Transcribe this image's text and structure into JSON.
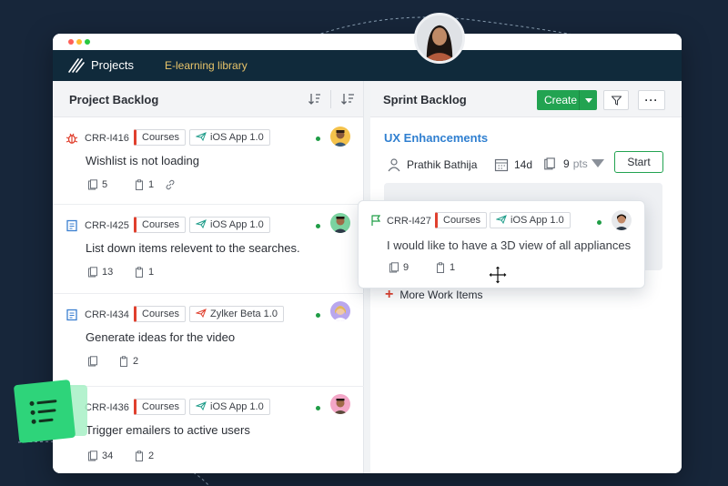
{
  "nav": {
    "title": "Projects",
    "library_link": "E-learning library"
  },
  "backlog": {
    "title": "Project Backlog",
    "items": [
      {
        "id": "CRR-I416",
        "type": "bug",
        "tag": "Courses",
        "release": "iOS App 1.0",
        "title": "Wishlist is not loading",
        "subtasks": "5",
        "attachments": "1",
        "has_link": true
      },
      {
        "id": "CRR-I425",
        "type": "story",
        "tag": "Courses",
        "release": "iOS App 1.0",
        "title": "List down items relevent to the searches.",
        "subtasks": "13",
        "attachments": "1"
      },
      {
        "id": "CRR-I434",
        "type": "story",
        "tag": "Courses",
        "release": "Zylker Beta 1.0",
        "title": "Generate ideas for the video",
        "subtasks": "",
        "attachments": "2"
      },
      {
        "id": "CRR-I436",
        "type": "task",
        "tag": "Courses",
        "release": "iOS App 1.0",
        "title": "Trigger emailers to active users",
        "subtasks": "34",
        "attachments": "2"
      }
    ]
  },
  "sprint": {
    "title": "Sprint Backlog",
    "create_label": "Create",
    "more_label": "···",
    "name": "UX Enhancements",
    "owner": "Prathik Bathija",
    "duration": "14d",
    "points": "9",
    "points_unit": "pts",
    "start_label": "Start",
    "more_items_label": "More Work Items"
  },
  "dragged": {
    "id": "CRR-I427",
    "tag": "Courses",
    "release": "iOS App 1.0",
    "title": "I would like to have a 3D view of all appliances",
    "subtasks": "9",
    "attachments": "1"
  },
  "colors": {
    "accent_green": "#22a351",
    "nav_bg": "#102a3b",
    "link_blue": "#2f7fd0",
    "course_red": "#e0402e",
    "library_gold": "#e8c46a"
  }
}
